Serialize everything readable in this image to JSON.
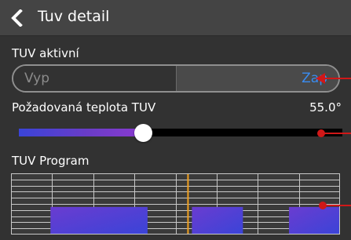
{
  "header": {
    "title": "Tuv detail",
    "back_icon": "chevron-left-icon"
  },
  "tuv_active": {
    "label": "TUV aktivní",
    "off_label": "Vyp",
    "on_label": "Zap",
    "selected": "Zap"
  },
  "temperature": {
    "label": "Požadovaná teplota TUV",
    "value": "55.0°",
    "slider_fraction": 0.385
  },
  "program": {
    "label": "TUV Program",
    "current_time_fraction": 0.538,
    "blocks": [
      {
        "start": 0.12,
        "end": 0.415
      },
      {
        "start": 0.55,
        "end": 0.705
      },
      {
        "start": 0.845,
        "end": 1.0
      }
    ]
  },
  "colors": {
    "accent_blue": "#3a8cf0",
    "annotation_red": "#d01818",
    "time_marker": "#f0a020"
  }
}
